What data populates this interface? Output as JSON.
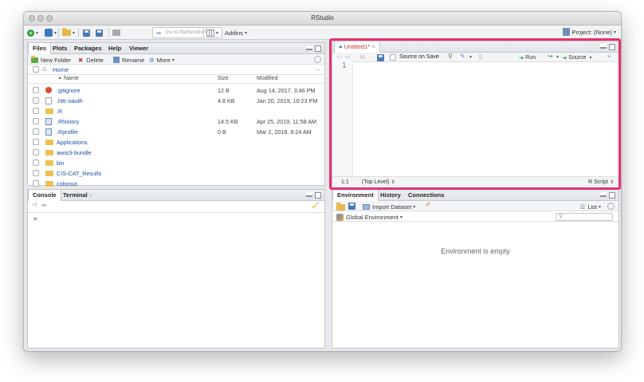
{
  "window": {
    "title": "RStudio"
  },
  "toolbar": {
    "goto_placeholder": "Go to file/function",
    "addins_label": "Addins",
    "project_label": "Project: (None)"
  },
  "files_pane": {
    "tabs": [
      "Files",
      "Plots",
      "Packages",
      "Help",
      "Viewer"
    ],
    "actions": {
      "new_folder": "New Folder",
      "delete": "Delete",
      "rename": "Rename",
      "more": "More"
    },
    "breadcrumb": "Home",
    "columns": {
      "name": "Name",
      "size": "Size",
      "modified": "Modified"
    },
    "files": [
      {
        "name": ".gitignore",
        "size": "12 B",
        "modified": "Aug 14, 2017, 3:46 PM",
        "type": "git"
      },
      {
        "name": ".httr-oauth",
        "size": "4.8 KB",
        "modified": "Jan 20, 2019, 10:23 PM",
        "type": "doc"
      },
      {
        "name": ".R",
        "size": "",
        "modified": "",
        "type": "folder"
      },
      {
        "name": ".Rhistory",
        "size": "14.5 KB",
        "modified": "Apr 25, 2019, 11:58 AM",
        "type": "r"
      },
      {
        "name": ".Rprofile",
        "size": "0 B",
        "modified": "Mar 2, 2018, 8:24 AM",
        "type": "r"
      },
      {
        "name": "Applications",
        "size": "",
        "modified": "",
        "type": "folder"
      },
      {
        "name": "awscli-bundle",
        "size": "",
        "modified": "",
        "type": "folder"
      },
      {
        "name": "bin",
        "size": "",
        "modified": "",
        "type": "folder"
      },
      {
        "name": "CIS-CAT_Results",
        "size": "",
        "modified": "",
        "type": "folder"
      },
      {
        "name": "colorout",
        "size": "",
        "modified": "",
        "type": "folder"
      }
    ]
  },
  "editor": {
    "tab_label": "Untitled1*",
    "source_on_save": "Source on Save",
    "run_label": "Run",
    "source_label": "Source",
    "line_number": "1",
    "status_position": "1:1",
    "status_scope": "(Top Level)",
    "file_type": "R Script",
    "highlight_color": "#e8316e"
  },
  "console_pane": {
    "tabs": [
      "Console",
      "Terminal"
    ],
    "path": "~/",
    "prompt": ">"
  },
  "env_pane": {
    "tabs": [
      "Environment",
      "History",
      "Connections"
    ],
    "import_dataset": "Import Dataset",
    "list_label": "List",
    "global_env": "Global Environment",
    "empty_message": "Environment is empty"
  }
}
